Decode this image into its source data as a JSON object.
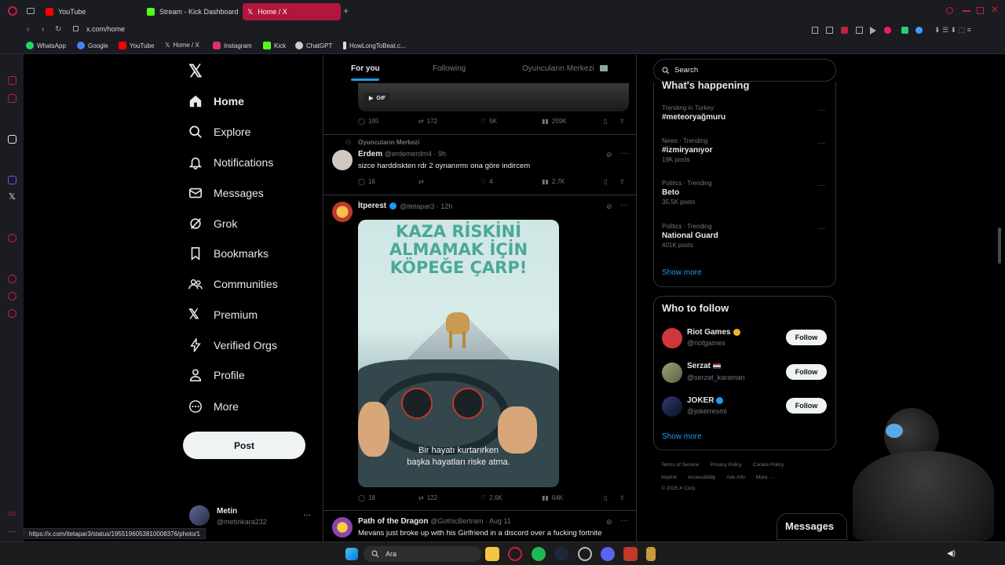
{
  "browser": {
    "tabs": [
      {
        "label": "YouTube",
        "color": "#ff0000"
      },
      {
        "label": "Stream - Kick Dashboard",
        "color": "#53fc18"
      },
      {
        "label": "Home / X",
        "color": "#ffffff",
        "active": true
      }
    ],
    "new_tab": "+",
    "url": "x.com/home",
    "bookmarks": [
      {
        "label": "WhatsApp",
        "color": "#25d366"
      },
      {
        "label": "Google",
        "color": "#4285f4"
      },
      {
        "label": "YouTube",
        "color": "#ff0000"
      },
      {
        "label": "Home / X",
        "color": "#ffffff"
      },
      {
        "label": "Instagram",
        "color": "#e1306c"
      },
      {
        "label": "Kick",
        "color": "#53fc18"
      },
      {
        "label": "ChatGPT",
        "color": "#cccccc"
      },
      {
        "label": "HowLongToBeat.c...",
        "color": "#dddddd"
      }
    ],
    "status_url": "https://x.com/itetapar3/status/1955196053810008376/photo/1"
  },
  "nav": {
    "items": [
      "Home",
      "Explore",
      "Notifications",
      "Messages",
      "Grok",
      "Bookmarks",
      "Communities",
      "Premium",
      "Verified Orgs",
      "Profile",
      "More"
    ],
    "post_button": "Post",
    "account": {
      "name": "Metin",
      "handle": "@metinkara232",
      "more": "···"
    }
  },
  "feed": {
    "tabs": [
      "For you",
      "Following",
      "Oyuncuların Merkezi"
    ],
    "gif_label": "GIF",
    "post1_actions": {
      "replies": "195",
      "reposts": "172",
      "likes": "5K",
      "views": "259K"
    },
    "post2": {
      "context": "Oyuncuların Merkezi",
      "name": "Erdem",
      "handle": "@erdemerdm4 · 9h",
      "text": "sizce harddiskten rdr 2 oynanırmı ona göre indircem",
      "replies": "16",
      "reposts": "",
      "likes": "4",
      "views": "2.7K"
    },
    "post3": {
      "name": "İtperest",
      "handle": "@itetapar3 · 12h",
      "image_top": "KAZA RİSKİNİ\nALMAMAK İÇİN\nKÖPEĞE ÇARP!",
      "image_bottom": "Bir hayatı kurtarırken\nbaşka hayatları riske atma.",
      "replies": "18",
      "reposts": "122",
      "likes": "2.6K",
      "views": "64K"
    },
    "post4": {
      "name": "Path of the Dragon",
      "handle": "@GothicBertram · Aug 11",
      "text": "Mevans just broke up with his Girlfriend in a discord over a fucking fortnite"
    }
  },
  "right": {
    "search_placeholder": "Search",
    "happening_title": "What's happening",
    "trends": [
      {
        "meta": "Trending in Turkey",
        "name": "#meteoryağmuru",
        "count": ""
      },
      {
        "meta": "News · Trending",
        "name": "#izmiryanıyor",
        "count": "19K posts"
      },
      {
        "meta": "Politics · Trending",
        "name": "Beto",
        "count": "35.5K posts"
      },
      {
        "meta": "Politics · Trending",
        "name": "National Guard",
        "count": "401K posts"
      }
    ],
    "show_more": "Show more",
    "follow_title": "Who to follow",
    "follow": [
      {
        "name": "Riot Games",
        "handle": "@riotgames",
        "button": "Follow"
      },
      {
        "name": "Serzat",
        "handle": "@serzat_karaman",
        "button": "Follow"
      },
      {
        "name": "JOKER",
        "handle": "@jokerresmi",
        "button": "Follow"
      }
    ],
    "footer": [
      "Terms of Service",
      "Privacy Policy",
      "Cookie Policy",
      "Imprint",
      "Accessibility",
      "Ads info",
      "More ···",
      "© 2025 X Corp."
    ],
    "messages_label": "Messages"
  },
  "taskbar": {
    "search": "Ara"
  }
}
